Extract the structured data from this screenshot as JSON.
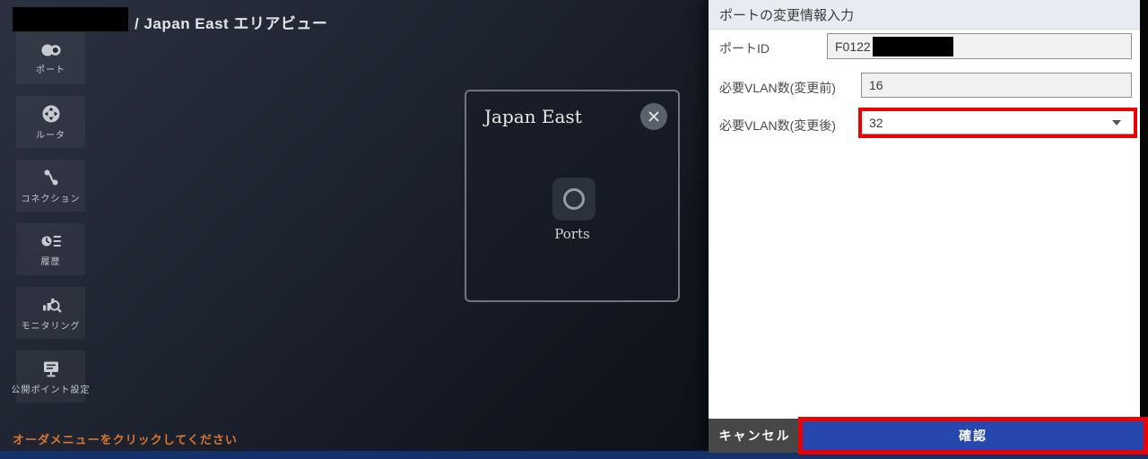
{
  "topbar": {
    "breadcrumb": "/ Japan East エリアビュー"
  },
  "sidebar": {
    "items": [
      {
        "label": "ポート",
        "icon": "ports-icon"
      },
      {
        "label": "ルータ",
        "icon": "router-icon"
      },
      {
        "label": "コネクション",
        "icon": "connection-icon"
      },
      {
        "label": "履歴",
        "icon": "history-icon"
      },
      {
        "label": "モニタリング",
        "icon": "monitoring-icon"
      },
      {
        "label": "公開ポイント設定",
        "icon": "public-point-icon"
      }
    ]
  },
  "canvas": {
    "card": {
      "title": "Japan East",
      "port_label": "Ports"
    },
    "status_message": "オーダメニューをクリックしてください"
  },
  "panel": {
    "title": "ポートの変更情報入力",
    "fields": [
      {
        "label": "ポートID",
        "value": "F0122",
        "redacted": true
      },
      {
        "label": "必要VLAN数(変更前)",
        "value": "16"
      },
      {
        "label": "必要VLAN数(変更後)",
        "value": "32",
        "highlighted": true
      }
    ],
    "buttons": {
      "cancel": "キャンセル",
      "confirm": "確認"
    }
  },
  "colors": {
    "confirm_blue": "#2547ae",
    "highlight_red": "#ec0000",
    "status_orange": "#d9752f",
    "bottom_bar_navy": "#14316b",
    "canvas_dark": "#1e2330"
  }
}
